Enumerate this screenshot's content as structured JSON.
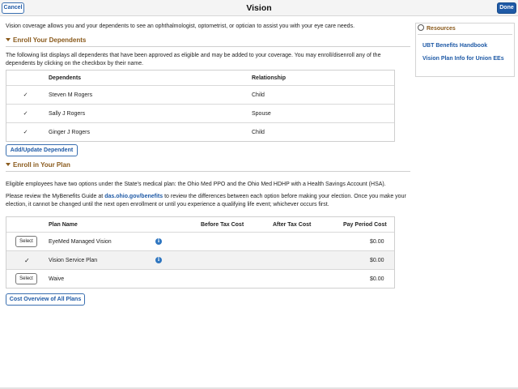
{
  "header": {
    "cancel_label": "Cancel",
    "title": "Vision",
    "done_label": "Done"
  },
  "intro": "Vision coverage allows you and your dependents to see an ophthalmologist, optometrist, or optician to assist you with your eye care needs.",
  "dependents_section": {
    "heading": "Enroll Your Dependents",
    "description": "The following list displays all dependents that have been approved as eligible and may be added to your coverage. You may enroll/disenroll any of the dependents by clicking on the checkbox by their name.",
    "columns": [
      "Dependents",
      "Relationship"
    ],
    "rows": [
      {
        "name": "Steven M Rogers",
        "relationship": "Child",
        "checked": true
      },
      {
        "name": "Sally J Rogers",
        "relationship": "Spouse",
        "checked": true
      },
      {
        "name": "Ginger J Rogers",
        "relationship": "Child",
        "checked": true
      }
    ],
    "add_button": "Add/Update Dependent"
  },
  "plan_section": {
    "heading": "Enroll in Your Plan",
    "description1": "Eligible employees have two options under the State's medical plan: the Ohio Med PPO and the Ohio Med HDHP with a Health Savings Account (HSA).",
    "description2_before": "Please review the MyBenefits Guide at",
    "description2_link": "das.ohio.gov/benefits",
    "description2_after": "to review the differences between each option before making your election. Once you make your election, it cannot be changed until the next open enrollment or until you experience a qualifying life event; whichever occurs first.",
    "columns": [
      "Plan Name",
      "Before Tax Cost",
      "After Tax Cost",
      "Pay Period Cost"
    ],
    "rows": [
      {
        "action": "Select",
        "selected": false,
        "name": "EyeMed Managed Vision",
        "info": true,
        "pay_period_cost": "$0.00"
      },
      {
        "action": "",
        "selected": true,
        "name": "Vision Service Plan",
        "info": true,
        "pay_period_cost": "$0.00"
      },
      {
        "action": "Select",
        "selected": false,
        "name": "Waive",
        "info": false,
        "pay_period_cost": "$0.00"
      }
    ],
    "overview_button": "Cost Overview of All Plans"
  },
  "resources": {
    "heading": "Resources",
    "links": [
      "UBT Benefits Handbook",
      "Vision Plan Info for Union EEs"
    ]
  },
  "icons": {
    "checkbox_checked": "✓",
    "selected_check": "✓",
    "info": "i"
  },
  "colors": {
    "accent_blue": "#1f5aa6",
    "section_brown": "#8a5a1c",
    "info_blue": "#2f76c0"
  }
}
